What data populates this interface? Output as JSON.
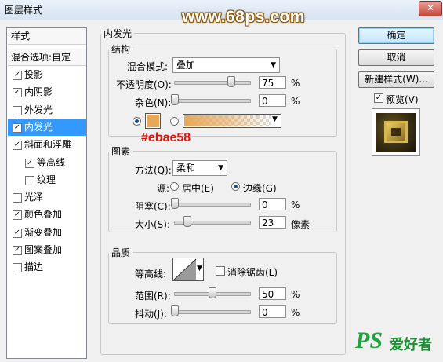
{
  "window": {
    "title": "图层样式",
    "close_label": "✕"
  },
  "watermark": "www.68ps.com",
  "style_list": {
    "header": "样式",
    "blend_options": "混合选项:自定",
    "items": [
      {
        "label": "投影",
        "checked": true
      },
      {
        "label": "内阴影",
        "checked": true
      },
      {
        "label": "外发光",
        "checked": false
      },
      {
        "label": "内发光",
        "checked": true,
        "selected": true
      },
      {
        "label": "斜面和浮雕",
        "checked": true
      },
      {
        "label": "等高线",
        "checked": true,
        "indent": true
      },
      {
        "label": "纹理",
        "checked": false,
        "indent": true
      },
      {
        "label": "光泽",
        "checked": false
      },
      {
        "label": "颜色叠加",
        "checked": true
      },
      {
        "label": "渐变叠加",
        "checked": true
      },
      {
        "label": "图案叠加",
        "checked": true
      },
      {
        "label": "描边",
        "checked": false
      }
    ]
  },
  "inner_glow": {
    "title": "内发光",
    "structure": {
      "title": "结构",
      "blend_mode_label": "混合模式:",
      "blend_mode_value": "叠加",
      "opacity_label": "不透明度(O):",
      "opacity_value": "75",
      "opacity_level": 75,
      "noise_label": "杂色(N):",
      "noise_value": "0",
      "noise_level": 0,
      "percent": "%",
      "glow_color": "#e8a85a"
    },
    "color_annotation": "#ebae58",
    "elements": {
      "title": "图素",
      "technique_label": "方法(Q):",
      "technique_value": "柔和",
      "source_label": "源:",
      "source_center": "居中(E)",
      "source_edge": "边缘(G)",
      "choke_label": "阻塞(C):",
      "choke_value": "0",
      "choke_level": 0,
      "size_label": "大小(S):",
      "size_value": "23",
      "size_unit": "像素",
      "percent": "%"
    },
    "quality": {
      "title": "品质",
      "contour_label": "等高线:",
      "antialias_label": "消除锯齿(L)",
      "antialias_checked": false,
      "range_label": "范围(R):",
      "range_value": "50",
      "range_level": 50,
      "jitter_label": "抖动(J):",
      "jitter_value": "0",
      "jitter_level": 0,
      "percent": "%"
    }
  },
  "buttons": {
    "ok": "确定",
    "cancel": "取消",
    "new_style": "新建样式(W)...",
    "preview_label": "预览(V)",
    "preview_checked": true
  },
  "logo": {
    "ps": "PS",
    "text": "爱好者"
  }
}
